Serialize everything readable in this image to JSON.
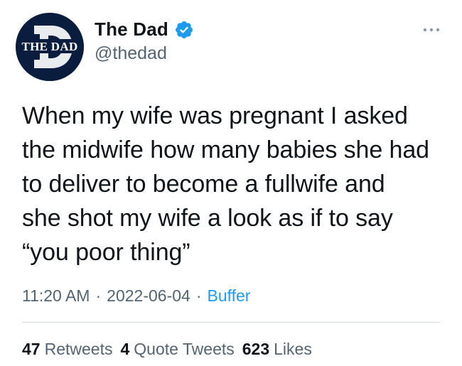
{
  "author": {
    "name": "The Dad",
    "handle": "@thedad",
    "avatar_text": "THE DAD",
    "avatar_letter": "D",
    "verified": true
  },
  "tweet": {
    "text": "When my wife was pregnant I asked\nthe midwife how many babies she had\nto deliver to become a fullwife and\nshe shot my wife a look as if to say\n“you poor thing”"
  },
  "meta": {
    "time": "11:20 AM",
    "date": "2022-06-04",
    "separator": "·",
    "source": "Buffer"
  },
  "stats": {
    "retweets": {
      "count": "47",
      "label": "Retweets"
    },
    "quote_tweets": {
      "count": "4",
      "label": "Quote Tweets"
    },
    "likes": {
      "count": "623",
      "label": "Likes"
    }
  },
  "colors": {
    "accent": "#1d9bf0",
    "muted": "#536471",
    "text": "#0f1419",
    "avatar_bg": "#0b1d3f"
  },
  "icons": {
    "verified": "verified-badge-icon",
    "more": "more-options-icon"
  }
}
